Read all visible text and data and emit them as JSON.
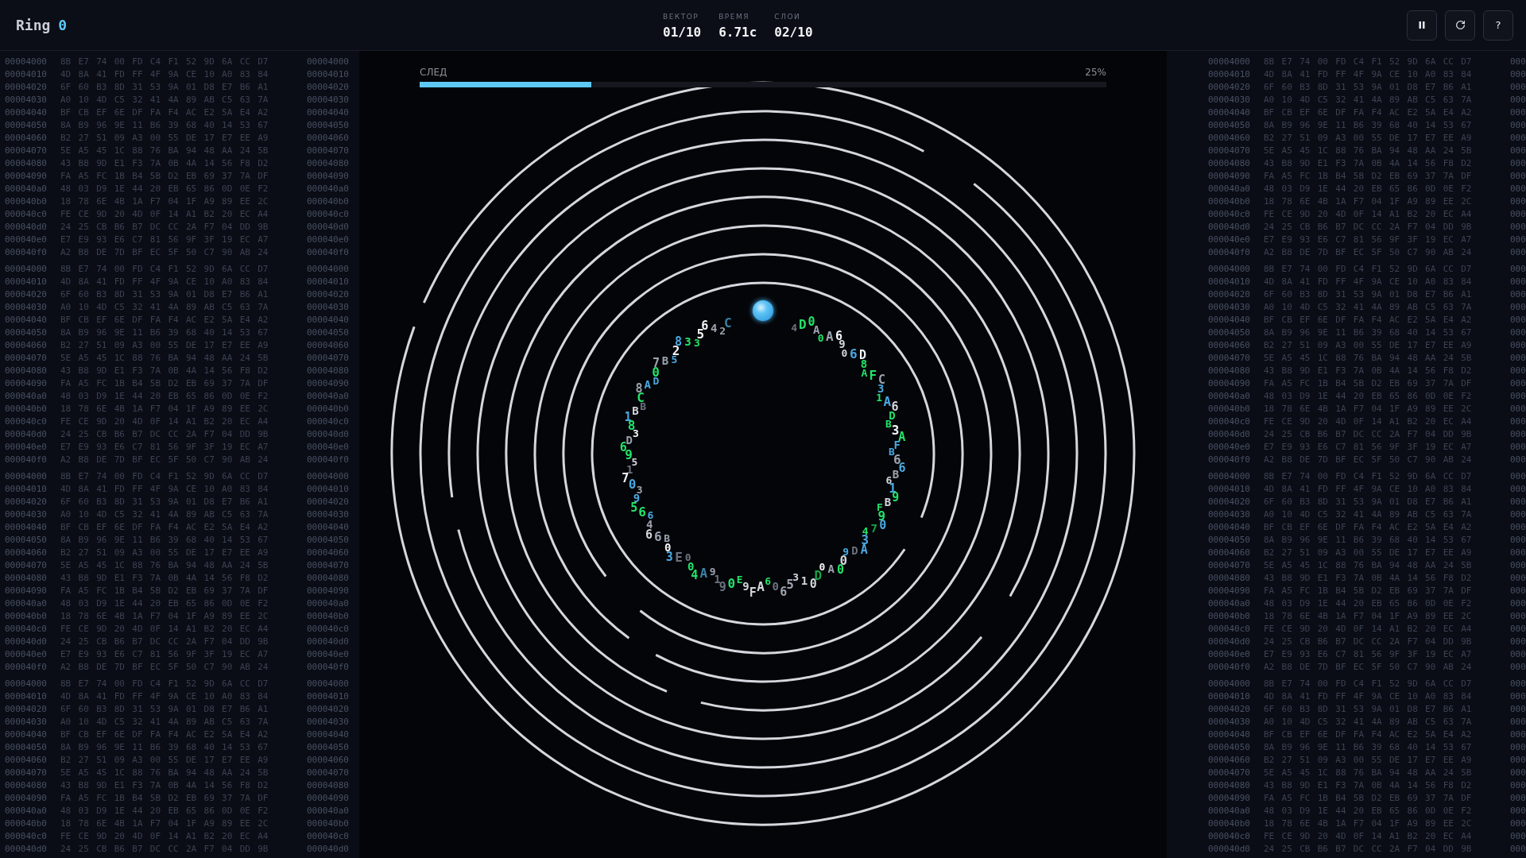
{
  "header": {
    "title": "Ring",
    "counter": "0",
    "stats": [
      {
        "label": "ВЕКТОР",
        "value": "01/10"
      },
      {
        "label": "ВРЕМЯ",
        "value": "6.71с"
      },
      {
        "label": "СЛОИ",
        "value": "02/10"
      }
    ],
    "buttons": [
      {
        "kind": "pause"
      },
      {
        "kind": "restart"
      },
      {
        "kind": "text",
        "label": "?"
      }
    ]
  },
  "hex_left": {
    "blocks": [
      {
        "rows": [
          {
            "address": "00004000",
            "bytes": "8B E7 74 00 FD C4 F1 52 9D 6A CC D7",
            "address_end": "00004000"
          },
          {
            "address": "00004010",
            "bytes": "4D 8A 41 FD FF 4F 9A CE 10 A0 83 84",
            "address_end": "00004010"
          },
          {
            "address": "00004020",
            "bytes": "6F 60 B3 8D 31 53 9A 01 D8 E7 B6 A1",
            "address_end": "00004020"
          },
          {
            "address": "00004030",
            "bytes": "A0 10 4D C5 32 41 4A 89 AB C5 63 7A",
            "address_end": "00004030"
          },
          {
            "address": "00004040",
            "bytes": "BF CB EF 6E DF FA F4 AC E2 5A E4 A2",
            "address_end": "00004040"
          },
          {
            "address": "00004050",
            "bytes": "8A B9 96 9E 11 B6 39 68 40 14 53 67",
            "address_end": "00004050"
          },
          {
            "address": "00004060",
            "bytes": "B2 27 51 09 A3 00 55 DE 17 E7 EE A9",
            "address_end": "00004060"
          },
          {
            "address": "00004070",
            "bytes": "5E A5 45 1C 88 76 BA 94 48 AA 24 5B",
            "address_end": "00004070"
          },
          {
            "address": "00004080",
            "bytes": "43 B8 9D E1 F3 7A 0B 4A 14 56 F8 D2",
            "address_end": "00004080"
          },
          {
            "address": "00004090",
            "bytes": "FA A5 FC 1B B4 5B D2 EB 69 37 7A DF",
            "address_end": "00004090"
          },
          {
            "address": "000040a0",
            "bytes": "48 03 D9 1E 44 20 EB 65 86 0D 0E F2",
            "address_end": "000040a0"
          },
          {
            "address": "000040b0",
            "bytes": "18 78 6E 4B 1A F7 04 1F A9 89 EE 2C",
            "address_end": "000040b0"
          },
          {
            "address": "000040c0",
            "bytes": "FE CE 9D 20 4D 0F 14 A1 B2 20 EC A4",
            "address_end": "000040c0"
          },
          {
            "address": "000040d0",
            "bytes": "24 25 CB B6 B7 DC CC 2A F7 04 DD 9B",
            "address_end": "000040d0"
          },
          {
            "address": "000040e0",
            "bytes": "E7 E9 93 E6 C7 81 56 9F 3F 19 EC A7",
            "address_end": "000040e0"
          },
          {
            "address": "000040f0",
            "bytes": "A2 B8 DE 7D BF EC 5F 50 C7 90 AB 24",
            "address_end": "000040f0"
          }
        ]
      },
      {
        "rows": [
          {
            "address": "00004000",
            "bytes": "8B E7 74 00 FD C4 F1 52 9D 6A CC D7",
            "address_end": "00004000"
          },
          {
            "address": "00004010",
            "bytes": "4D 8A 41 FD FF 4F 9A CE 10 A0 83 84",
            "address_end": "00004010"
          },
          {
            "address": "00004020",
            "bytes": "6F 60 B3 8D 31 53 9A 01 D8 E7 B6 A1",
            "address_end": "00004020"
          },
          {
            "address": "00004030",
            "bytes": "A0 10 4D C5 32 41 4A 89 AB C5 63 7A",
            "address_end": "00004030"
          },
          {
            "address": "00004040",
            "bytes": "BF CB EF 6E DF FA F4 AC E2 5A E4 A2",
            "address_end": "00004040"
          },
          {
            "address": "00004050",
            "bytes": "8A B9 96 9E 11 B6 39 68 40 14 53 67",
            "address_end": "00004050"
          },
          {
            "address": "00004060",
            "bytes": "B2 27 51 09 A3 00 55 DE 17 E7 EE A9",
            "address_end": "00004060"
          },
          {
            "address": "00004070",
            "bytes": "5E A5 45 1C 88 76 BA 94 48 AA 24 5B",
            "address_end": "00004070"
          },
          {
            "address": "00004080",
            "bytes": "43 B8 9D E1 F3 7A 0B 4A 14 56 F8 D2",
            "address_end": "00004080"
          },
          {
            "address": "00004090",
            "bytes": "FA A5 FC 1B B4 5B D2 EB 69 37 7A DF",
            "address_end": "00004090"
          },
          {
            "address": "000040a0",
            "bytes": "48 03 D9 1E 44 20 EB 65 86 0D 0E F2",
            "address_end": "000040a0"
          },
          {
            "address": "000040b0",
            "bytes": "18 78 6E 4B 1A F7 04 1F A9 89 EE 2C",
            "address_end": "000040b0"
          },
          {
            "address": "000040c0",
            "bytes": "FE CE 9D 20 4D 0F 14 A1 B2 20 EC A4",
            "address_end": "000040c0"
          },
          {
            "address": "000040d0",
            "bytes": "24 25 CB B6 B7 DC CC 2A F7 04 DD 9B",
            "address_end": "000040d0"
          },
          {
            "address": "000040e0",
            "bytes": "E7 E9 93 E6 C7 81 56 9F 3F 19 EC A7",
            "address_end": "000040e0"
          },
          {
            "address": "000040f0",
            "bytes": "A2 B8 DE 7D BF EC 5F 50 C7 90 AB 24",
            "address_end": "000040f0"
          }
        ]
      },
      {
        "rows": [
          {
            "address": "00004000",
            "bytes": "8B E7 74 00 FD C4 F1 52 9D 6A CC D7",
            "address_end": "00004000"
          },
          {
            "address": "00004010",
            "bytes": "4D 8A 41 FD FF 4F 9A CE 10 A0 83 84",
            "address_end": "00004010"
          },
          {
            "address": "00004020",
            "bytes": "6F 60 B3 8D 31 53 9A 01 D8 E7 B6 A1",
            "address_end": "00004020"
          },
          {
            "address": "00004030",
            "bytes": "A0 10 4D C5 32 41 4A 89 AB C5 63 7A",
            "address_end": "00004030"
          },
          {
            "address": "00004040",
            "bytes": "BF CB EF 6E DF FA F4 AC E2 5A E4 A2",
            "address_end": "00004040"
          },
          {
            "address": "00004050",
            "bytes": "8A B9 96 9E 11 B6 39 68 40 14 53 67",
            "address_end": "00004050"
          },
          {
            "address": "00004060",
            "bytes": "B2 27 51 09 A3 00 55 DE 17 E7 EE A9",
            "address_end": "00004060"
          },
          {
            "address": "00004070",
            "bytes": "5E A5 45 1C 88 76 BA 94 48 AA 24 5B",
            "address_end": "00004070"
          },
          {
            "address": "00004080",
            "bytes": "43 B8 9D E1 F3 7A 0B 4A 14 56 F8 D2",
            "address_end": "00004080"
          },
          {
            "address": "00004090",
            "bytes": "FA A5 FC 1B B4 5B D2 EB 69 37 7A DF",
            "address_end": "00004090"
          },
          {
            "address": "000040a0",
            "bytes": "48 03 D9 1E 44 20 EB 65 86 0D 0E F2",
            "address_end": "000040a0"
          },
          {
            "address": "000040b0",
            "bytes": "18 78 6E 4B 1A F7 04 1F A9 89 EE 2C",
            "address_end": "000040b0"
          },
          {
            "address": "000040c0",
            "bytes": "FE CE 9D 20 4D 0F 14 A1 B2 20 EC A4",
            "address_end": "000040c0"
          },
          {
            "address": "000040d0",
            "bytes": "24 25 CB B6 B7 DC CC 2A F7 04 DD 9B",
            "address_end": "000040d0"
          },
          {
            "address": "000040e0",
            "bytes": "E7 E9 93 E6 C7 81 56 9F 3F 19 EC A7",
            "address_end": "000040e0"
          },
          {
            "address": "000040f0",
            "bytes": "A2 B8 DE 7D BF EC 5F 50 C7 90 AB 24",
            "address_end": "000040f0"
          }
        ]
      },
      {
        "rows": [
          {
            "address": "00004000",
            "bytes": "8B E7 74 00 FD C4 F1 52 9D 6A CC D7",
            "address_end": "00004000"
          },
          {
            "address": "00004010",
            "bytes": "4D 8A 41 FD FF 4F 9A CE 10 A0 83 84",
            "address_end": "00004010"
          },
          {
            "address": "00004020",
            "bytes": "6F 60 B3 8D 31 53 9A 01 D8 E7 B6 A1",
            "address_end": "00004020"
          },
          {
            "address": "00004030",
            "bytes": "A0 10 4D C5 32 41 4A 89 AB C5 63 7A",
            "address_end": "00004030"
          },
          {
            "address": "00004040",
            "bytes": "BF CB EF 6E DF FA F4 AC E2 5A E4 A2",
            "address_end": "00004040"
          },
          {
            "address": "00004050",
            "bytes": "8A B9 96 9E 11 B6 39 68 40 14 53 67",
            "address_end": "00004050"
          },
          {
            "address": "00004060",
            "bytes": "B2 27 51 09 A3 00 55 DE 17 E7 EE A9",
            "address_end": "00004060"
          },
          {
            "address": "00004070",
            "bytes": "5E A5 45 1C 88 76 BA 94 48 AA 24 5B",
            "address_end": "00004070"
          },
          {
            "address": "00004080",
            "bytes": "43 B8 9D E1 F3 7A 0B 4A 14 56 F8 D2",
            "address_end": "00004080"
          },
          {
            "address": "00004090",
            "bytes": "FA A5 FC 1B B4 5B D2 EB 69 37 7A DF",
            "address_end": "00004090"
          },
          {
            "address": "000040a0",
            "bytes": "48 03 D9 1E 44 20 EB 65 86 0D 0E F2",
            "address_end": "000040a0"
          },
          {
            "address": "000040b0",
            "bytes": "18 78 6E 4B 1A F7 04 1F A9 89 EE 2C",
            "address_end": "000040b0"
          },
          {
            "address": "000040c0",
            "bytes": "FE CE 9D 20 4D 0F 14 A1 B2 20 EC A4",
            "address_end": "000040c0"
          },
          {
            "address": "000040d0",
            "bytes": "24 25 CB B6 B7 DC CC 2A F7 04 DD 9B",
            "address_end": "000040d0"
          }
        ]
      }
    ]
  },
  "hex_right": {
    "blocks": [
      {
        "rows": [
          {
            "address": "00004000",
            "bytes": "8B E7 74 00 FD C4 F1 52 9D 6A CC D7",
            "address_end": "000"
          },
          {
            "address": "00004010",
            "bytes": "4D 8A 41 FD FF 4F 9A CE 10 A0 83 84",
            "address_end": "000"
          },
          {
            "address": "00004020",
            "bytes": "6F 60 B3 8D 31 53 9A 01 D8 E7 B6 A1",
            "address_end": "000"
          },
          {
            "address": "00004030",
            "bytes": "A0 10 4D C5 32 41 4A 89 AB C5 63 7A",
            "address_end": "000"
          },
          {
            "address": "00004040",
            "bytes": "BF CB EF 6E DF FA F4 AC E2 5A E4 A2",
            "address_end": "000"
          },
          {
            "address": "00004050",
            "bytes": "8A B9 96 9E 11 B6 39 68 40 14 53 67",
            "address_end": "000"
          },
          {
            "address": "00004060",
            "bytes": "B2 27 51 09 A3 00 55 DE 17 E7 EE A9",
            "address_end": "000"
          },
          {
            "address": "00004070",
            "bytes": "5E A5 45 1C 88 76 BA 94 48 AA 24 5B",
            "address_end": "000"
          },
          {
            "address": "00004080",
            "bytes": "43 B8 9D E1 F3 7A 0B 4A 14 56 F8 D2",
            "address_end": "000"
          },
          {
            "address": "00004090",
            "bytes": "FA A5 FC 1B B4 5B D2 EB 69 37 7A DF",
            "address_end": "000"
          },
          {
            "address": "000040a0",
            "bytes": "48 03 D9 1E 44 20 EB 65 86 0D 0E F2",
            "address_end": "000"
          },
          {
            "address": "000040b0",
            "bytes": "18 78 6E 4B 1A F7 04 1F A9 89 EE 2C",
            "address_end": "000"
          },
          {
            "address": "000040c0",
            "bytes": "FE CE 9D 20 4D 0F 14 A1 B2 20 EC A4",
            "address_end": "000"
          },
          {
            "address": "000040d0",
            "bytes": "24 25 CB B6 B7 DC CC 2A F7 04 DD 9B",
            "address_end": "000"
          },
          {
            "address": "000040e0",
            "bytes": "E7 E9 93 E6 C7 81 56 9F 3F 19 EC A7",
            "address_end": "000"
          },
          {
            "address": "000040f0",
            "bytes": "A2 B8 DE 7D BF EC 5F 50 C7 90 AB 24",
            "address_end": "000"
          }
        ]
      },
      {
        "rows": [
          {
            "address": "00004000",
            "bytes": "8B E7 74 00 FD C4 F1 52 9D 6A CC D7",
            "address_end": "000"
          },
          {
            "address": "00004010",
            "bytes": "4D 8A 41 FD FF 4F 9A CE 10 A0 83 84",
            "address_end": "000"
          },
          {
            "address": "00004020",
            "bytes": "6F 60 B3 8D 31 53 9A 01 D8 E7 B6 A1",
            "address_end": "000"
          },
          {
            "address": "00004030",
            "bytes": "A0 10 4D C5 32 41 4A 89 AB C5 63 7A",
            "address_end": "000"
          },
          {
            "address": "00004040",
            "bytes": "BF CB EF 6E DF FA F4 AC E2 5A E4 A2",
            "address_end": "000"
          },
          {
            "address": "00004050",
            "bytes": "8A B9 96 9E 11 B6 39 68 40 14 53 67",
            "address_end": "000"
          },
          {
            "address": "00004060",
            "bytes": "B2 27 51 09 A3 00 55 DE 17 E7 EE A9",
            "address_end": "000"
          },
          {
            "address": "00004070",
            "bytes": "5E A5 45 1C 88 76 BA 94 48 AA 24 5B",
            "address_end": "000"
          },
          {
            "address": "00004080",
            "bytes": "43 B8 9D E1 F3 7A 0B 4A 14 56 F8 D2",
            "address_end": "000"
          },
          {
            "address": "00004090",
            "bytes": "FA A5 FC 1B B4 5B D2 EB 69 37 7A DF",
            "address_end": "000"
          },
          {
            "address": "000040a0",
            "bytes": "48 03 D9 1E 44 20 EB 65 86 0D 0E F2",
            "address_end": "000"
          },
          {
            "address": "000040b0",
            "bytes": "18 78 6E 4B 1A F7 04 1F A9 89 EE 2C",
            "address_end": "000"
          },
          {
            "address": "000040c0",
            "bytes": "FE CE 9D 20 4D 0F 14 A1 B2 20 EC A4",
            "address_end": "000"
          },
          {
            "address": "000040d0",
            "bytes": "24 25 CB B6 B7 DC CC 2A F7 04 DD 9B",
            "address_end": "000"
          },
          {
            "address": "000040e0",
            "bytes": "E7 E9 93 E6 C7 81 56 9F 3F 19 EC A7",
            "address_end": "000"
          },
          {
            "address": "000040f0",
            "bytes": "A2 B8 DE 7D BF EC 5F 50 C7 90 AB 24",
            "address_end": "000"
          }
        ]
      },
      {
        "rows": [
          {
            "address": "00004000",
            "bytes": "8B E7 74 00 FD C4 F1 52 9D 6A CC D7",
            "address_end": "000"
          },
          {
            "address": "00004010",
            "bytes": "4D 8A 41 FD FF 4F 9A CE 10 A0 83 84",
            "address_end": "000"
          },
          {
            "address": "00004020",
            "bytes": "6F 60 B3 8D 31 53 9A 01 D8 E7 B6 A1",
            "address_end": "000"
          },
          {
            "address": "00004030",
            "bytes": "A0 10 4D C5 32 41 4A 89 AB C5 63 7A",
            "address_end": "000"
          },
          {
            "address": "00004040",
            "bytes": "BF CB EF 6E DF FA F4 AC E2 5A E4 A2",
            "address_end": "000"
          },
          {
            "address": "00004050",
            "bytes": "8A B9 96 9E 11 B6 39 68 40 14 53 67",
            "address_end": "000"
          },
          {
            "address": "00004060",
            "bytes": "B2 27 51 09 A3 00 55 DE 17 E7 EE A9",
            "address_end": "000"
          },
          {
            "address": "00004070",
            "bytes": "5E A5 45 1C 88 76 BA 94 48 AA 24 5B",
            "address_end": "000"
          },
          {
            "address": "00004080",
            "bytes": "43 B8 9D E1 F3 7A 0B 4A 14 56 F8 D2",
            "address_end": "000"
          },
          {
            "address": "00004090",
            "bytes": "FA A5 FC 1B B4 5B D2 EB 69 37 7A DF",
            "address_end": "000"
          },
          {
            "address": "000040a0",
            "bytes": "48 03 D9 1E 44 20 EB 65 86 0D 0E F2",
            "address_end": "000"
          },
          {
            "address": "000040b0",
            "bytes": "18 78 6E 4B 1A F7 04 1F A9 89 EE 2C",
            "address_end": "000"
          },
          {
            "address": "000040c0",
            "bytes": "FE CE 9D 20 4D 0F 14 A1 B2 20 EC A4",
            "address_end": "000"
          },
          {
            "address": "000040d0",
            "bytes": "24 25 CB B6 B7 DC CC 2A F7 04 DD 9B",
            "address_end": "000"
          },
          {
            "address": "000040e0",
            "bytes": "E7 E9 93 E6 C7 81 56 9F 3F 19 EC A7",
            "address_end": "000"
          },
          {
            "address": "000040f0",
            "bytes": "A2 B8 DE 7D BF EC 5F 50 C7 90 AB 24",
            "address_end": "000"
          }
        ]
      },
      {
        "rows": [
          {
            "address": "00004000",
            "bytes": "8B E7 74 00 FD C4 F1 52 9D 6A CC D7",
            "address_end": "000"
          },
          {
            "address": "00004010",
            "bytes": "4D 8A 41 FD FF 4F 9A CE 10 A0 83 84",
            "address_end": "000"
          },
          {
            "address": "00004020",
            "bytes": "6F 60 B3 8D 31 53 9A 01 D8 E7 B6 A1",
            "address_end": "000"
          },
          {
            "address": "00004030",
            "bytes": "A0 10 4D C5 32 41 4A 89 AB C5 63 7A",
            "address_end": "000"
          },
          {
            "address": "00004040",
            "bytes": "BF CB EF 6E DF FA F4 AC E2 5A E4 A2",
            "address_end": "000"
          },
          {
            "address": "00004050",
            "bytes": "8A B9 96 9E 11 B6 39 68 40 14 53 67",
            "address_end": "000"
          },
          {
            "address": "00004060",
            "bytes": "B2 27 51 09 A3 00 55 DE 17 E7 EE A9",
            "address_end": "000"
          },
          {
            "address": "00004070",
            "bytes": "5E A5 45 1C 88 76 BA 94 48 AA 24 5B",
            "address_end": "000"
          },
          {
            "address": "00004080",
            "bytes": "43 B8 9D E1 F3 7A 0B 4A 14 56 F8 D2",
            "address_end": "000"
          },
          {
            "address": "00004090",
            "bytes": "FA A5 FC 1B B4 5B D2 EB 69 37 7A DF",
            "address_end": "000"
          },
          {
            "address": "000040a0",
            "bytes": "48 03 D9 1E 44 20 EB 65 86 0D 0E F2",
            "address_end": "000"
          },
          {
            "address": "000040b0",
            "bytes": "18 78 6E 4B 1A F7 04 1F A9 89 EE 2C",
            "address_end": "000"
          },
          {
            "address": "000040c0",
            "bytes": "FE CE 9D 20 4D 0F 14 A1 B2 20 EC A4",
            "address_end": "000"
          },
          {
            "address": "000040d0",
            "bytes": "24 25 CB B6 B7 DC CC 2A F7 04 DD 9B",
            "address_end": "000"
          }
        ]
      }
    ]
  },
  "trail": {
    "label": "СЛЕД",
    "level": 0.25,
    "reading": "25%"
  },
  "ring_glyphs": [
    {
      "char": "6",
      "color": "#f3f4f6"
    },
    {
      "char": "4",
      "color": "#9ca3af"
    },
    {
      "char": "C",
      "color": "#3b82a6"
    },
    {
      "char": "4",
      "color": "#6b7280"
    },
    {
      "char": "D",
      "color": "#22e36a"
    },
    {
      "char": "0",
      "color": "#22e36a"
    },
    {
      "char": "5",
      "color": "#f3f4f6"
    },
    {
      "char": "2",
      "color": "#9ca3af"
    },
    {
      "char": "A",
      "color": "#9ca3af"
    },
    {
      "char": "8",
      "color": "#4aa8e0"
    },
    {
      "char": "3",
      "color": "#22e36a"
    },
    {
      "char": "3",
      "color": "#22e36a"
    },
    {
      "char": "0",
      "color": "#22e36a"
    },
    {
      "char": "A",
      "color": "#9ca3af"
    },
    {
      "char": "6",
      "color": "#f3f4f6"
    },
    {
      "char": "9",
      "color": "#d1d5db"
    },
    {
      "char": "2",
      "color": "#f3f4f6"
    },
    {
      "char": "0",
      "color": "#d1d5db"
    },
    {
      "char": "6",
      "color": "#4aa8e0"
    },
    {
      "char": "D",
      "color": "#f3f4f6"
    },
    {
      "char": "7",
      "color": "#9ca3af"
    },
    {
      "char": "B",
      "color": "#9ca3af"
    },
    {
      "char": "5",
      "color": "#4aa8e0"
    },
    {
      "char": "8",
      "color": "#22e36a"
    },
    {
      "char": "0",
      "color": "#22e36a"
    },
    {
      "char": "A",
      "color": "#22e36a"
    },
    {
      "char": "F",
      "color": "#22e36a"
    },
    {
      "char": "C",
      "color": "#9ca3af"
    },
    {
      "char": "8",
      "color": "#9ca3af"
    },
    {
      "char": "A",
      "color": "#4aa8e0"
    },
    {
      "char": "D",
      "color": "#4aa8e0"
    },
    {
      "char": "3",
      "color": "#4aa8e0"
    },
    {
      "char": "C",
      "color": "#22e36a"
    },
    {
      "char": "1",
      "color": "#22e36a"
    },
    {
      "char": "B",
      "color": "#6b7280"
    },
    {
      "char": "A",
      "color": "#4aa8e0"
    },
    {
      "char": "B",
      "color": "#d1d5db"
    },
    {
      "char": "6",
      "color": "#d1d5db"
    },
    {
      "char": "1",
      "color": "#4aa8e0"
    },
    {
      "char": "D",
      "color": "#22e36a"
    },
    {
      "char": "8",
      "color": "#22e36a"
    },
    {
      "char": "B",
      "color": "#22e36a"
    },
    {
      "char": "3",
      "color": "#f3f4f6"
    },
    {
      "char": "3",
      "color": "#f3f4f6"
    },
    {
      "char": "D",
      "color": "#9ca3af"
    },
    {
      "char": "A",
      "color": "#22e36a"
    },
    {
      "char": "6",
      "color": "#22e36a"
    },
    {
      "char": "F",
      "color": "#4aa8e0"
    },
    {
      "char": "9",
      "color": "#22e36a"
    },
    {
      "char": "B",
      "color": "#4aa8e0"
    },
    {
      "char": "5",
      "color": "#d1d5db"
    },
    {
      "char": "6",
      "color": "#9ca3af"
    },
    {
      "char": "1",
      "color": "#6b7280"
    },
    {
      "char": "6",
      "color": "#4aa8e0"
    },
    {
      "char": "7",
      "color": "#f3f4f6"
    },
    {
      "char": "B",
      "color": "#9ca3af"
    },
    {
      "char": "0",
      "color": "#4aa8e0"
    },
    {
      "char": "6",
      "color": "#d1d5db"
    },
    {
      "char": "3",
      "color": "#9ca3af"
    },
    {
      "char": "1",
      "color": "#4aa8e0"
    },
    {
      "char": "9",
      "color": "#4aa8e0"
    },
    {
      "char": "9",
      "color": "#22e36a"
    },
    {
      "char": "5",
      "color": "#22e36a"
    },
    {
      "char": "F",
      "color": "#22e36a"
    },
    {
      "char": "B",
      "color": "#d1d5db"
    },
    {
      "char": "6",
      "color": "#22e36a"
    },
    {
      "char": "6",
      "color": "#4aa8e0"
    },
    {
      "char": "9",
      "color": "#22e36a"
    },
    {
      "char": "4",
      "color": "#9ca3af"
    },
    {
      "char": "6",
      "color": "#d1d5db"
    },
    {
      "char": "4",
      "color": "#22e36a"
    },
    {
      "char": "7",
      "color": "#16a34a"
    },
    {
      "char": "0",
      "color": "#4aa8e0"
    },
    {
      "char": "6",
      "color": "#9ca3af"
    },
    {
      "char": "B",
      "color": "#9ca3af"
    },
    {
      "char": "3",
      "color": "#4aa8e0"
    },
    {
      "char": "0",
      "color": "#f3f4f6"
    },
    {
      "char": "9",
      "color": "#4aa8e0"
    },
    {
      "char": "D",
      "color": "#6b7280"
    },
    {
      "char": "A",
      "color": "#4aa8e0"
    },
    {
      "char": "3",
      "color": "#4aa8e0"
    },
    {
      "char": "E",
      "color": "#6b7280"
    },
    {
      "char": "0",
      "color": "#6b7280"
    },
    {
      "char": "0",
      "color": "#d1d5db"
    },
    {
      "char": "0",
      "color": "#22e36a"
    },
    {
      "char": "0",
      "color": "#f3f4f6"
    },
    {
      "char": "A",
      "color": "#9ca3af"
    },
    {
      "char": "0",
      "color": "#22e36a"
    },
    {
      "char": "4",
      "color": "#22e36a"
    },
    {
      "char": "A",
      "color": "#3b82a6"
    },
    {
      "char": "9",
      "color": "#9ca3af"
    },
    {
      "char": "1",
      "color": "#6b7280"
    },
    {
      "char": "3",
      "color": "#d1d5db"
    },
    {
      "char": "D",
      "color": "#16a34a"
    },
    {
      "char": "0",
      "color": "#22e36a"
    },
    {
      "char": "E",
      "color": "#22e36a"
    },
    {
      "char": "6",
      "color": "#22e36a"
    },
    {
      "char": "9",
      "color": "#6b7280"
    },
    {
      "char": "9",
      "color": "#d1d5db"
    },
    {
      "char": "A",
      "color": "#d1d5db"
    },
    {
      "char": "5",
      "color": "#9ca3af"
    },
    {
      "char": "1",
      "color": "#d1d5db"
    },
    {
      "char": "0",
      "color": "#6b7280"
    },
    {
      "char": "0",
      "color": "#d1d5db"
    },
    {
      "char": "F",
      "color": "#d1d5db"
    },
    {
      "char": "6",
      "color": "#9ca3af"
    }
  ]
}
